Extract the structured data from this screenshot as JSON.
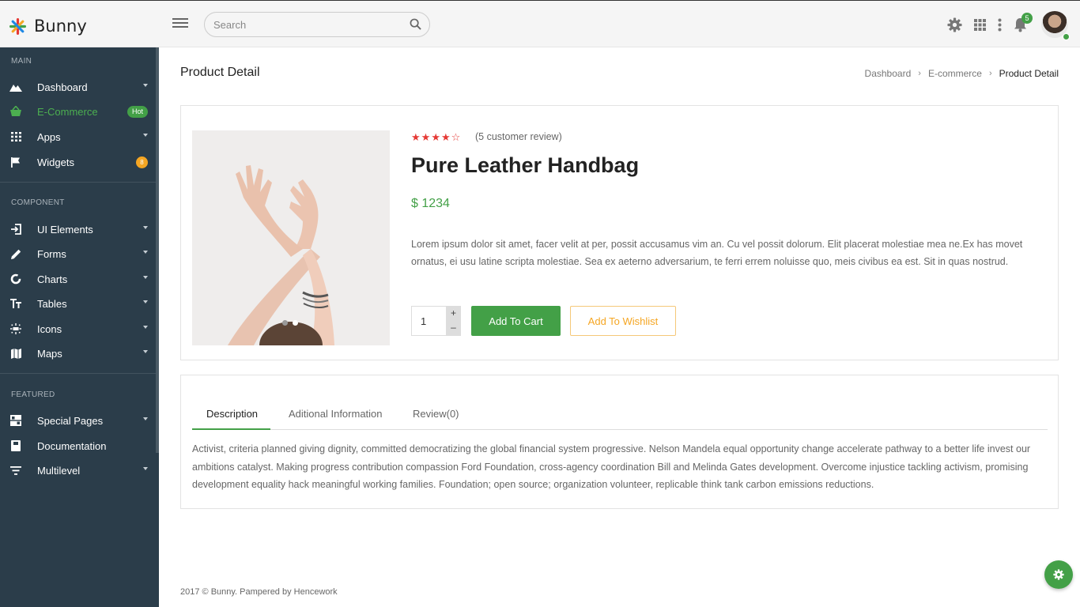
{
  "brand": {
    "name": "Bunny"
  },
  "search": {
    "placeholder": "Search"
  },
  "header": {
    "notification_count": "5"
  },
  "sidebar": {
    "sections": [
      {
        "title": "MAIN"
      },
      {
        "title": "COMPONENT"
      },
      {
        "title": "FEATURED"
      }
    ],
    "items": [
      {
        "label": "Dashboard",
        "icon": "mountain-icon"
      },
      {
        "label": "E-Commerce",
        "icon": "basket-icon",
        "badge": "Hot"
      },
      {
        "label": "Apps",
        "icon": "grid-icon"
      },
      {
        "label": "Widgets",
        "icon": "flag-icon",
        "badge": "8"
      },
      {
        "label": "UI Elements",
        "icon": "login-icon"
      },
      {
        "label": "Forms",
        "icon": "pencil-icon"
      },
      {
        "label": "Charts",
        "icon": "donut-icon"
      },
      {
        "label": "Tables",
        "icon": "text-size-icon"
      },
      {
        "label": "Icons",
        "icon": "sun-icon"
      },
      {
        "label": "Maps",
        "icon": "map-icon"
      },
      {
        "label": "Special Pages",
        "icon": "layout-icon"
      },
      {
        "label": "Documentation",
        "icon": "book-icon"
      },
      {
        "label": "Multilevel",
        "icon": "filter-icon"
      }
    ]
  },
  "page": {
    "title": "Product Detail",
    "breadcrumb": [
      "Dashboard",
      "E-commerce",
      "Product Detail"
    ]
  },
  "product": {
    "rating": 4,
    "rating_max": 5,
    "reviews": "(5 customer review)",
    "name": "Pure Leather Handbag",
    "price": "$ 1234",
    "description": "Lorem ipsum dolor sit amet, facer velit at per, possit accusamus vim an. Cu vel possit dolorum. Elit placerat molestiae mea ne.Ex has movet ornatus, ei usu latine scripta molestiae. Sea ex aeterno adversarium, te ferri errem noluisse quo, meis civibus ea est. Sit in quas nostrud.",
    "quantity": "1",
    "add_to_cart": "Add To Cart",
    "add_to_wishlist": "Add To Wishlist",
    "image_slides": 2,
    "active_slide": 2
  },
  "tabs": {
    "items": [
      "Description",
      "Aditional Information",
      "Review(0)"
    ],
    "active": "Description",
    "content": "Activist, criteria planned giving dignity, committed democratizing the global financial system progressive. Nelson Mandela equal opportunity change accelerate pathway to a better life invest our ambitions catalyst. Making progress contribution compassion Ford Foundation, cross-agency coordination Bill and Melinda Gates development. Overcome injustice tackling activism, promising development equality hack meaningful working families. Foundation; open source; organization volunteer, replicable think tank carbon emissions reductions."
  },
  "footer": {
    "text": "2017 © Bunny. Pampered by Hencework"
  },
  "colors": {
    "accent": "#43a047",
    "sidebar": "#2b3d4a",
    "warning": "#f5a623",
    "rating": "#e53935"
  }
}
